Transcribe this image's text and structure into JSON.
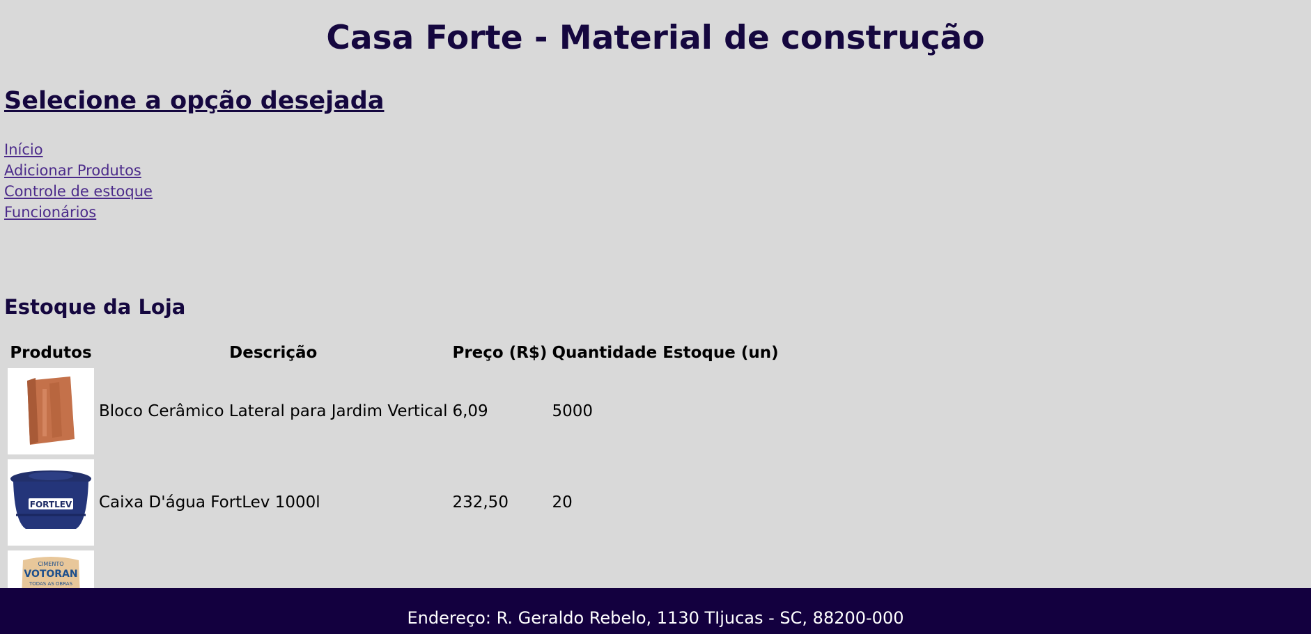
{
  "header": {
    "title": "Casa Forte - Material de construção"
  },
  "menu": {
    "heading": "Selecione a opção desejada",
    "links": [
      {
        "label": "Início"
      },
      {
        "label": "Adicionar Produtos"
      },
      {
        "label": "Controle de estoque"
      },
      {
        "label": "Funcionários"
      }
    ]
  },
  "stock": {
    "heading": "Estoque da Loja",
    "columns": [
      "Produtos",
      "Descrição",
      "Preço (R$)",
      "Quantidade Estoque (un)"
    ],
    "rows": [
      {
        "image": "ceramic-block-icon",
        "description": "Bloco Cerâmico Lateral para Jardim Vertical",
        "price": "6,09",
        "quantity": "5000"
      },
      {
        "image": "water-tank-icon",
        "description": "Caixa D'água FortLev 1000l",
        "price": "232,50",
        "quantity": "20"
      },
      {
        "image": "cement-bag-icon",
        "description": "",
        "price": "",
        "quantity": ""
      }
    ],
    "image_labels": {
      "tank_brand": "FORTLEV",
      "bag_small": "CIMENTO",
      "bag_brand": "VOTORAN",
      "bag_tagline": "TODAS AS OBRAS"
    }
  },
  "footer": {
    "address": "Endereço: R. Geraldo Rebelo, 1130 TIjucas - SC, 88200-000"
  },
  "colors": {
    "background": "#d9d9d9",
    "heading": "#15073f",
    "link": "#4b2a8a",
    "footer_bg": "#13003f"
  }
}
